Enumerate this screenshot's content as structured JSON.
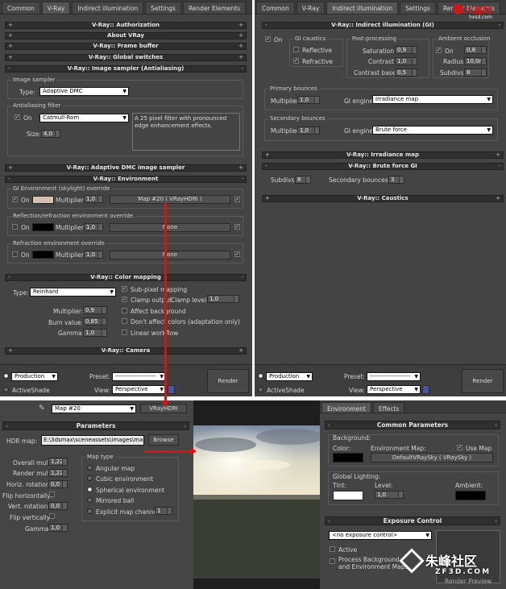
{
  "left_panel": {
    "tabs": [
      "Common",
      "V-Ray",
      "Indirect illumination",
      "Settings",
      "Render Elements"
    ],
    "rollouts": {
      "authorization": "V-Ray:: Authorization",
      "about": "About VRay",
      "frame_buffer": "V-Ray:: Frame buffer",
      "global_switches": "V-Ray:: Global switches",
      "image_sampler": "V-Ray:: Image sampler (Antialiasing)",
      "adaptive_dmc": "V-Ray:: Adaptive DMC image sampler",
      "environment": "V-Ray:: Environment",
      "color_mapping": "V-Ray:: Color mapping",
      "camera": "V-Ray:: Camera"
    },
    "image_sampler": {
      "group": "Image sampler",
      "type_label": "Type:",
      "type_value": "Adaptive DMC"
    },
    "aa_filter": {
      "group": "Antialiasing filter",
      "on_label": "On",
      "filter_value": "Catmull-Rom",
      "description": "A 25 pixel filter with pronounced edge enhancement effects.",
      "size_label": "Size:",
      "size_value": "4,0"
    },
    "environment": {
      "gi_group": "GI Environment (skylight) override",
      "on_label": "On",
      "multiplier_label": "Multiplier:",
      "gi_multiplier": "1,0",
      "gi_map": "Map #20  ( VRayHDRI )",
      "refl_group": "Reflection/refraction environment override",
      "refl_multiplier": "1,0",
      "refl_map": "None",
      "refr_group": "Refraction environment override",
      "refr_multiplier": "1,0",
      "refr_map": "None",
      "gi_color": "#d9bfb2"
    },
    "color_mapping": {
      "type_label": "Type:",
      "type_value": "Reinhard",
      "subpixel": "Sub-pixel mapping",
      "clamp_output": "Clamp output",
      "clamp_level_label": "Clamp level:",
      "clamp_level": "1,0",
      "affect_bg": "Affect background",
      "dont_affect": "Don't affect colors (adaptation only)",
      "linear": "Linear workflow",
      "multiplier_label": "Multiplier:",
      "multiplier": "0,9",
      "burn_label": "Burn value:",
      "burn": "0,85",
      "gamma_label": "Gamma:",
      "gamma": "1,0"
    },
    "bottom": {
      "production": "Production",
      "activeshade": "ActiveShade",
      "preset_label": "Preset:",
      "preset_value": "--------------------",
      "view_label": "View:",
      "view_value": "Perspective",
      "render": "Render"
    }
  },
  "right_panel": {
    "tabs": [
      "Common",
      "V-Ray",
      "Indirect illumination",
      "Settings",
      "Render Elements"
    ],
    "logo_text": "火星网",
    "logo_url": "hxsd.com",
    "rollout_main": "V-Ray:: Indirect illumination (GI)",
    "on_label": "On",
    "gi_caustics": {
      "group": "GI caustics",
      "reflective": "Reflective",
      "refractive": "Refractive"
    },
    "post": {
      "group": "Post-processing",
      "saturation_label": "Saturation",
      "saturation": "0,9",
      "contrast_label": "Contrast",
      "contrast": "1,0",
      "contrast_base_label": "Contrast base",
      "contrast_base": "0,5"
    },
    "ao": {
      "group": "Ambient occlusion",
      "on_label": "On",
      "value": "0,8",
      "radius_label": "Radius",
      "radius": "10,0mi",
      "subdivs_label": "Subdivs",
      "subdivs": "8"
    },
    "primary": {
      "group": "Primary bounces",
      "multiplier_label": "Multiplier",
      "multiplier": "1,0",
      "engine_label": "GI engine",
      "engine": "Irradiance map"
    },
    "secondary": {
      "group": "Secondary bounces",
      "multiplier_label": "Multiplier",
      "multiplier": "1,0",
      "engine_label": "GI engine",
      "engine": "Brute force"
    },
    "rollouts": {
      "irradiance": "V-Ray:: Irradiance map",
      "brute": "V-Ray:: Brute force GI",
      "caustics": "V-Ray:: Caustics"
    },
    "brute": {
      "subdivs_label": "Subdivs:",
      "subdivs": "8",
      "bounces_label": "Secondary bounces:",
      "bounces": "3"
    },
    "bottom": {
      "production": "Production",
      "activeshade": "ActiveShade",
      "preset_label": "Preset:",
      "preset_value": "--------------------",
      "view_label": "View:",
      "view_value": "Perspective",
      "render": "Render"
    }
  },
  "hdri_panel": {
    "map_name": "Map #20",
    "map_type": "VRayHDRI",
    "params_header": "Parameters",
    "hdr_label": "HDR map:",
    "hdr_path": "E:\\3dsmax\\sceneassets\\images\\maps",
    "browse": "Browse",
    "overall_label": "Overall mult:",
    "overall": "1,22",
    "render_label": "Render mult:",
    "render": "1,22",
    "horiz_label": "Horiz. rotation:",
    "horiz": "0,0",
    "flip_h": "Flip horizontally:",
    "vert_label": "Vert. rotation:",
    "vert": "0,0",
    "flip_v": "Flip vertically",
    "gamma_label": "Gamma:",
    "gamma": "1,0",
    "map_type_group": "Map type",
    "types": [
      "Angular map",
      "Cubic environment",
      "Spherical environment",
      "Mirrored ball",
      "Explicit map channel"
    ],
    "channel": "1"
  },
  "env_panel": {
    "tabs": [
      "Environment",
      "Effects"
    ],
    "common_header": "Common Parameters",
    "background_group": "Background:",
    "color_label": "Color:",
    "env_map_label": "Environment Map:",
    "use_map": "Use Map",
    "env_map_value": "DefaultVRaySky  ( VRaySky )",
    "global_lighting": "Global Lighting:",
    "tint_label": "Tint:",
    "level_label": "Level:",
    "level": "1,0",
    "ambient_label": "Ambient:",
    "exposure_header": "Exposure Control",
    "exposure_value": "<no exposure control>",
    "active": "Active",
    "process_bg": "Process Background",
    "env_maps": "and Environment Maps",
    "render_preview": "Render Preview"
  },
  "watermark": {
    "cn": "朱峰社区",
    "en": "ZF3D.COM"
  }
}
